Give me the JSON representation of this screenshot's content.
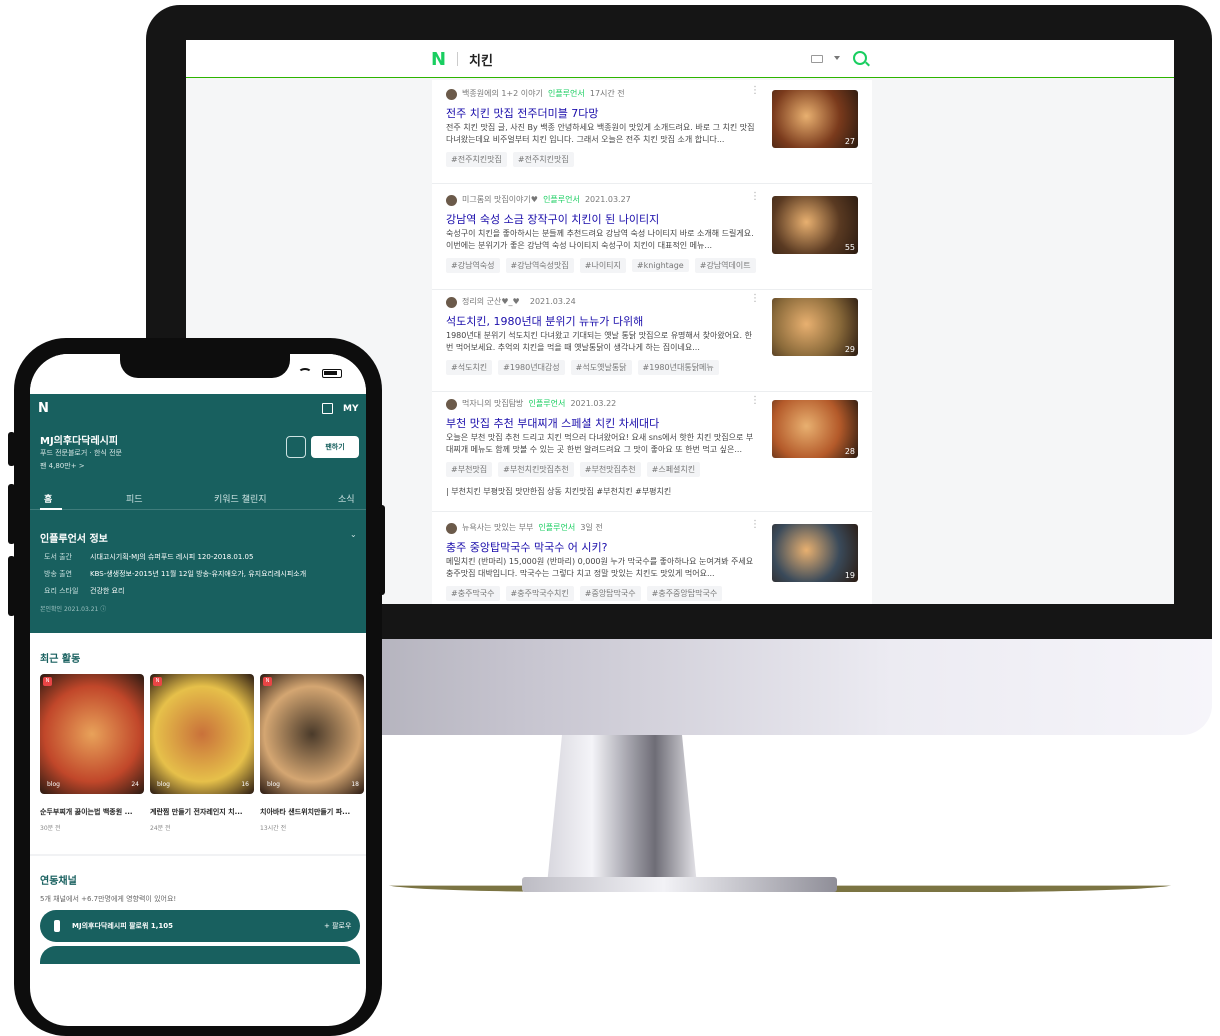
{
  "desktop": {
    "logo": "N",
    "query": "치킨",
    "results": [
      {
        "author": "백종원에의 1+2 이야기",
        "badge": "인플루언서",
        "time": "17시간 전",
        "title": "전주 치킨 맛집 전주더미블 7다망",
        "desc": "전주 치킨 맛집 글, 사진 By 백종 안녕하세요 백종원이 맛있게 소개드려요. 바로 그 치킨 맛집 다녀왔는데요 비주얼부터 치킨 입니다. 그래서 오늘은 전주 치킨 맛집 소개 합니다...",
        "tags": [
          "#전주치킨맛집",
          "#전주치킨맛집"
        ],
        "count": "27",
        "thumb_color": "#7a3a1c"
      },
      {
        "author": "미그롬의 맛집이야기♥",
        "badge": "인플루언서",
        "time": "2021.03.27",
        "title": "강남역 숙성 소금 장작구이 치킨이 된 나이티지",
        "desc": "숙성구이 치킨을 좋아하시는 분들께 추천드려요 강남역 숙성 나이티지 바로 소개해 드릴게요. 이번에는 분위기가 좋은 강남역 숙성 나이티지 숙성구이 치킨이 대표적인 메뉴...",
        "tags": [
          "#강남역숙성",
          "#강남역숙성맛집",
          "#나이티지",
          "#knightage",
          "#강남역데이트"
        ],
        "count": "55",
        "thumb_color": "#5a3a22"
      },
      {
        "author": "정리의 군산♥_♥",
        "badge": "",
        "time": "2021.03.24",
        "title": "석도치킨, 1980년대 분위기 뉴뉴가 다위해",
        "desc": "1980년대 분위기 석도치킨 다녀왔고 기대되는 옛날 통닭 맛집으로 유명해서 찾아왔어요. 한번 먹어보세요. 추억의 치킨을 먹을 때 옛날통닭이 생각나게 하는 집이네요...",
        "tags": [
          "#석도치킨",
          "#1980년대감성",
          "#석도옛날통닭",
          "#1980년대통닭메뉴"
        ],
        "count": "29",
        "thumb_color": "#8a6a3a"
      },
      {
        "author": "먹자니의 맛집탐방",
        "badge": "인플루언서",
        "time": "2021.03.22",
        "title": "부천 맛집 추천 부대찌개 스페셜 치킨 차세대다",
        "desc": "오늘은 부천 맛집 추천 드리고 치킨 먹으러 다녀왔어요! 요새 sns에서 핫한 치킨 맛집으로 부대찌개 메뉴도 함께 맛볼 수 있는 곳 한번 알려드려요 그 맛이 좋아요 또 한번 먹고 싶은...",
        "tags": [
          "#부천맛집",
          "#부천치킨맛집추천",
          "#부천맛집추천",
          "#스페셜치킨"
        ],
        "extra": "| 부천치킨 부평맛집 맛만한집 상동 치킨맛집 #부천치킨 #부평치킨",
        "count": "28",
        "thumb_color": "#b45a2a"
      },
      {
        "author": "뉴욕사는 맛있는 부부",
        "badge": "인플루언서",
        "time": "3일 전",
        "title": "충주 중앙탑막국수 막국수 어 시키?",
        "desc": "메밀치킨 (반마리) 15,000원 (반마리) 0,000원 누가 막국수를 좋아하나요 눈여겨봐 주세요 충주맛집 대박입니다. 막국수는 그렇다 치고 정말 맛있는 치킨도 맛있게 먹어요...",
        "tags": [
          "#충주막국수",
          "#충주막국수치킨",
          "#중앙탑막국수",
          "#충주중앙탑막국수"
        ],
        "count": "19",
        "thumb_color": "#3a4a5a"
      }
    ]
  },
  "mobile": {
    "logo": "N",
    "my_label": "MY",
    "profile_name": "MJ의후다닥레시피",
    "profile_sub": "푸드 전문블로거 · 한식 전문",
    "profile_fans": "팬 4,80만+ >",
    "follow_label": "팬하기",
    "tabs": [
      "홈",
      "피드",
      "키워드 챌린지",
      "소식"
    ],
    "info_title": "인플루언서 정보",
    "info_rows": [
      {
        "k": "도서 출간",
        "v": "시대고시기획-MJ의 슈퍼푸드 레시피 120-2018.01.05"
      },
      {
        "k": "방송 출연",
        "v": "KBS-생생정보-2015년 11월 12일 방송-유지애오가, 유지요리레시피소개"
      },
      {
        "k": "요리 스타일",
        "v": "건강한 요리"
      }
    ],
    "cert": "본인확인 2021.03.21 ⓘ",
    "recent_title": "최근 활동",
    "cards": [
      {
        "caption": "순두부찌개 끓이는법 백종원 ...",
        "time": "30분 전",
        "src": "blog",
        "count": "24",
        "badge": "N",
        "color1": "#c1472a",
        "color2": "#e8a25a"
      },
      {
        "caption": "계란찜 만들기 전자레인지 치...",
        "time": "24분 전",
        "src": "blog",
        "count": "16",
        "badge": "N",
        "color1": "#e6c04a",
        "color2": "#c9713a"
      },
      {
        "caption": "치아바타 샌드위치만들기 파...",
        "time": "13시간 전",
        "src": "blog",
        "count": "18",
        "badge": "N",
        "color1": "#d4a672",
        "color2": "#4a3a2a"
      }
    ],
    "linked_title": "연동채널",
    "linked_sub": "5개 채널에서 +6.7만명에게 영향력이 있어요!",
    "channel_name": "MJ의후다닥레시피  팔로워 1,105",
    "channel_follow": "+ 팔로우"
  }
}
